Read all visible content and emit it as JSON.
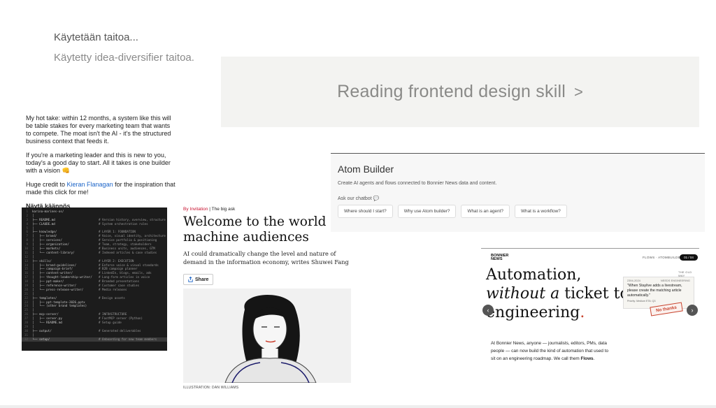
{
  "status": {
    "using_skill": "Käytetään taitoa...",
    "used_skill": "Käytetty idea-diversifier taitoa."
  },
  "banner": {
    "text": "Reading frontend design skill",
    "chevron": ">"
  },
  "post": {
    "p1": "My hot take: within 12 months, a system like this will be table stakes for every marketing team that wants to compete. The moat isn't the AI - it's the structured business context that feeds it.",
    "p2": "If you're a marketing leader and this is new to you, today's a good day to start. All it takes is one builder with a vision 👊",
    "p3_pre": "Huge credit to ",
    "p3_link": "Kieran Flanagan",
    "p3_post": " for the inspiration that made this click for me!",
    "translate": "Näytä käännös"
  },
  "code": {
    "lines": [
      {
        "n": "1",
        "l": "karina-marines-os/",
        "r": ""
      },
      {
        "n": "2",
        "l": "│",
        "r": ""
      },
      {
        "n": "3",
        "l": "├── README.md",
        "r": "# Version history, overview, structure"
      },
      {
        "n": "4",
        "l": "├── CLAUDE.md",
        "r": "# System orchestration rules"
      },
      {
        "n": "5",
        "l": "│",
        "r": ""
      },
      {
        "n": "6",
        "l": "├── knowledge/",
        "r": "# LAYER 1: FOUNDATION"
      },
      {
        "n": "7",
        "l": "│   ├── brand/",
        "r": "# Voice, visual identity, architecture"
      },
      {
        "n": "8",
        "l": "│   ├── services/",
        "r": "# Service portfolio & positioning"
      },
      {
        "n": "9",
        "l": "│   ├── organization/",
        "r": "# Team, strategy, stakeholders"
      },
      {
        "n": "10",
        "l": "│   ├── markets/",
        "r": "# Business units, audiences, GTM"
      },
      {
        "n": "11",
        "l": "│   └── content-library/",
        "r": "# Indexed articles & case studies"
      },
      {
        "n": "12",
        "l": "│",
        "r": ""
      },
      {
        "n": "13",
        "l": "├── skills/",
        "r": "# LAYER 2: EXECUTION"
      },
      {
        "n": "14",
        "l": "│   ├── brand-guidelines/",
        "r": "# Enforce voice & visual standards"
      },
      {
        "n": "15",
        "l": "│   ├── campaign-brief/",
        "r": "# B2B campaign planner"
      },
      {
        "n": "16",
        "l": "│   ├── content-writer/",
        "r": "# LinkedIn, blogs, emails, ads"
      },
      {
        "n": "17",
        "l": "│   ├── thought-leadership-writer/",
        "r": "# Long-form articles in voice"
      },
      {
        "n": "18",
        "l": "│   ├── ppt-maker/",
        "r": "# Branded presentations"
      },
      {
        "n": "19",
        "l": "│   ├── reference-writer/",
        "r": "# Customer case studies"
      },
      {
        "n": "20",
        "l": "│   └── press-release-writer/",
        "r": "# Media releases"
      },
      {
        "n": "21",
        "l": "│",
        "r": ""
      },
      {
        "n": "22",
        "l": "├── templates/",
        "r": "# Design assets"
      },
      {
        "n": "23",
        "l": "│   ├── ppt-template-2026.pptx",
        "r": ""
      },
      {
        "n": "24",
        "l": "│   └── (other brand templates)",
        "r": ""
      },
      {
        "n": "25",
        "l": "│",
        "r": ""
      },
      {
        "n": "26",
        "l": "├── mcp-server/",
        "r": "# INFRASTRUCTURE"
      },
      {
        "n": "27",
        "l": "│   ├── server.py",
        "r": "# FastMCP server (Python)"
      },
      {
        "n": "28",
        "l": "│   └── README.md",
        "r": "# Setup guide"
      },
      {
        "n": "29",
        "l": "│",
        "r": ""
      },
      {
        "n": "30",
        "l": "├── output/",
        "r": "# Generated deliverables"
      },
      {
        "n": "31",
        "l": "│",
        "r": ""
      },
      {
        "n": "32",
        "l": "└── setup/",
        "r": "# Onboarding for new team members"
      }
    ]
  },
  "article": {
    "kicker_red": "By Invitation",
    "kicker_rest": " | The big ask",
    "headline": "Welcome to the world of machine audiences",
    "dek": "AI could dramatically change the level and nature of demand in the information economy, writes Shuwei Fang",
    "share": "Share",
    "caption": "ILLUSTRATION: DAN WILLIAMS"
  },
  "atom": {
    "title": "Atom Builder",
    "subtitle": "Create AI agents and flows connected to Bonnier News data and content.",
    "ask": "Ask our chatbot 💬",
    "chips": [
      "Where should I start?",
      "Why use Atom builder?",
      "What is an agent?",
      "What is a workflow?"
    ]
  },
  "bonnier": {
    "logo_l1": "BONNIER",
    "logo_l2": "NEWS",
    "flows": "FLOWS · ATOMBUILDER",
    "pill": "01 / 04",
    "head_1": "Automation,",
    "head_2_it": "without a",
    "head_2_rest": " ticket to",
    "head_3": "engineering",
    "head_dot": ".",
    "tag": "THE OLD WAY",
    "card_date": "2394-2024",
    "card_dept": "NEEDS ENGINEERING",
    "card_quote": "\"When Staylive adds a livestream, please create the matching article automatically.\"",
    "card_priority": "Priority: Medium   ETA: Q3",
    "stamp": "No thanks",
    "body_pre": "At Bonnier News, anyone — journalists, editors, PMs, data people — can now build the kind of automation that used to sit on an engineering roadmap. We call them ",
    "body_bold": "Flows",
    "body_post": "."
  },
  "colors": {
    "link": "#1b64c8",
    "kicker_red": "#c8102e",
    "accent": "#c8442e"
  }
}
